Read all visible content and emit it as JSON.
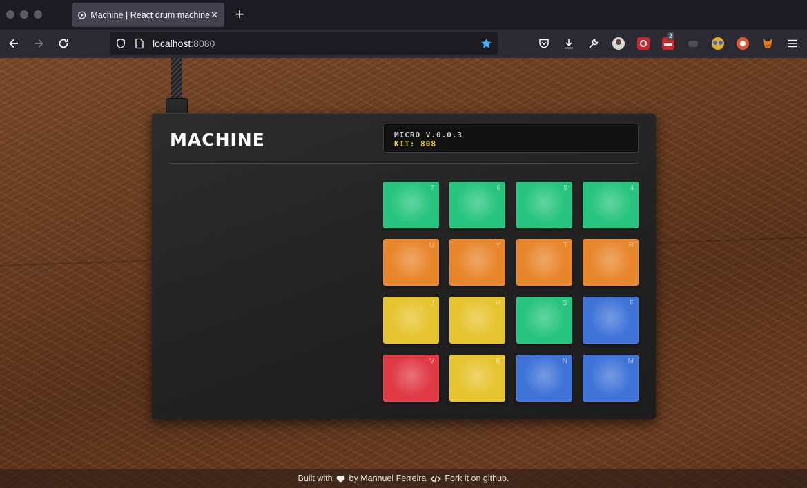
{
  "browser": {
    "tab_title": "Machine | React drum machine",
    "url_host": "localhost",
    "url_port": ":8080",
    "extension_badge": "2"
  },
  "device": {
    "logo": "MACHINE",
    "lcd_line1": "MICRO V.0.0.3",
    "lcd_line2": "KIT: 808"
  },
  "pads": [
    {
      "key": "7",
      "color": "#27c47f"
    },
    {
      "key": "6",
      "color": "#27c47f"
    },
    {
      "key": "5",
      "color": "#27c47f"
    },
    {
      "key": "4",
      "color": "#27c47f"
    },
    {
      "key": "U",
      "color": "#e8862c"
    },
    {
      "key": "Y",
      "color": "#e8862c"
    },
    {
      "key": "T",
      "color": "#e8862c"
    },
    {
      "key": "R",
      "color": "#e8862c"
    },
    {
      "key": "J",
      "color": "#e6c42f"
    },
    {
      "key": "H",
      "color": "#e6c42f"
    },
    {
      "key": "G",
      "color": "#27c47f"
    },
    {
      "key": "F",
      "color": "#3f73d8"
    },
    {
      "key": "V",
      "color": "#e03a45"
    },
    {
      "key": "B",
      "color": "#e6c42f"
    },
    {
      "key": "N",
      "color": "#3f73d8"
    },
    {
      "key": "M",
      "color": "#3f73d8"
    }
  ],
  "footer": {
    "built_with": "Built with",
    "by": "by Mannuel Ferreira",
    "fork": "Fork it on github."
  },
  "icons": [
    "play-icon",
    "back-icon",
    "forward-icon",
    "reload-icon",
    "shield-icon",
    "page-icon",
    "star-icon",
    "pocket-icon",
    "download-icon",
    "wrench-icon",
    "menu-icon",
    "heart-icon",
    "code-icon"
  ]
}
